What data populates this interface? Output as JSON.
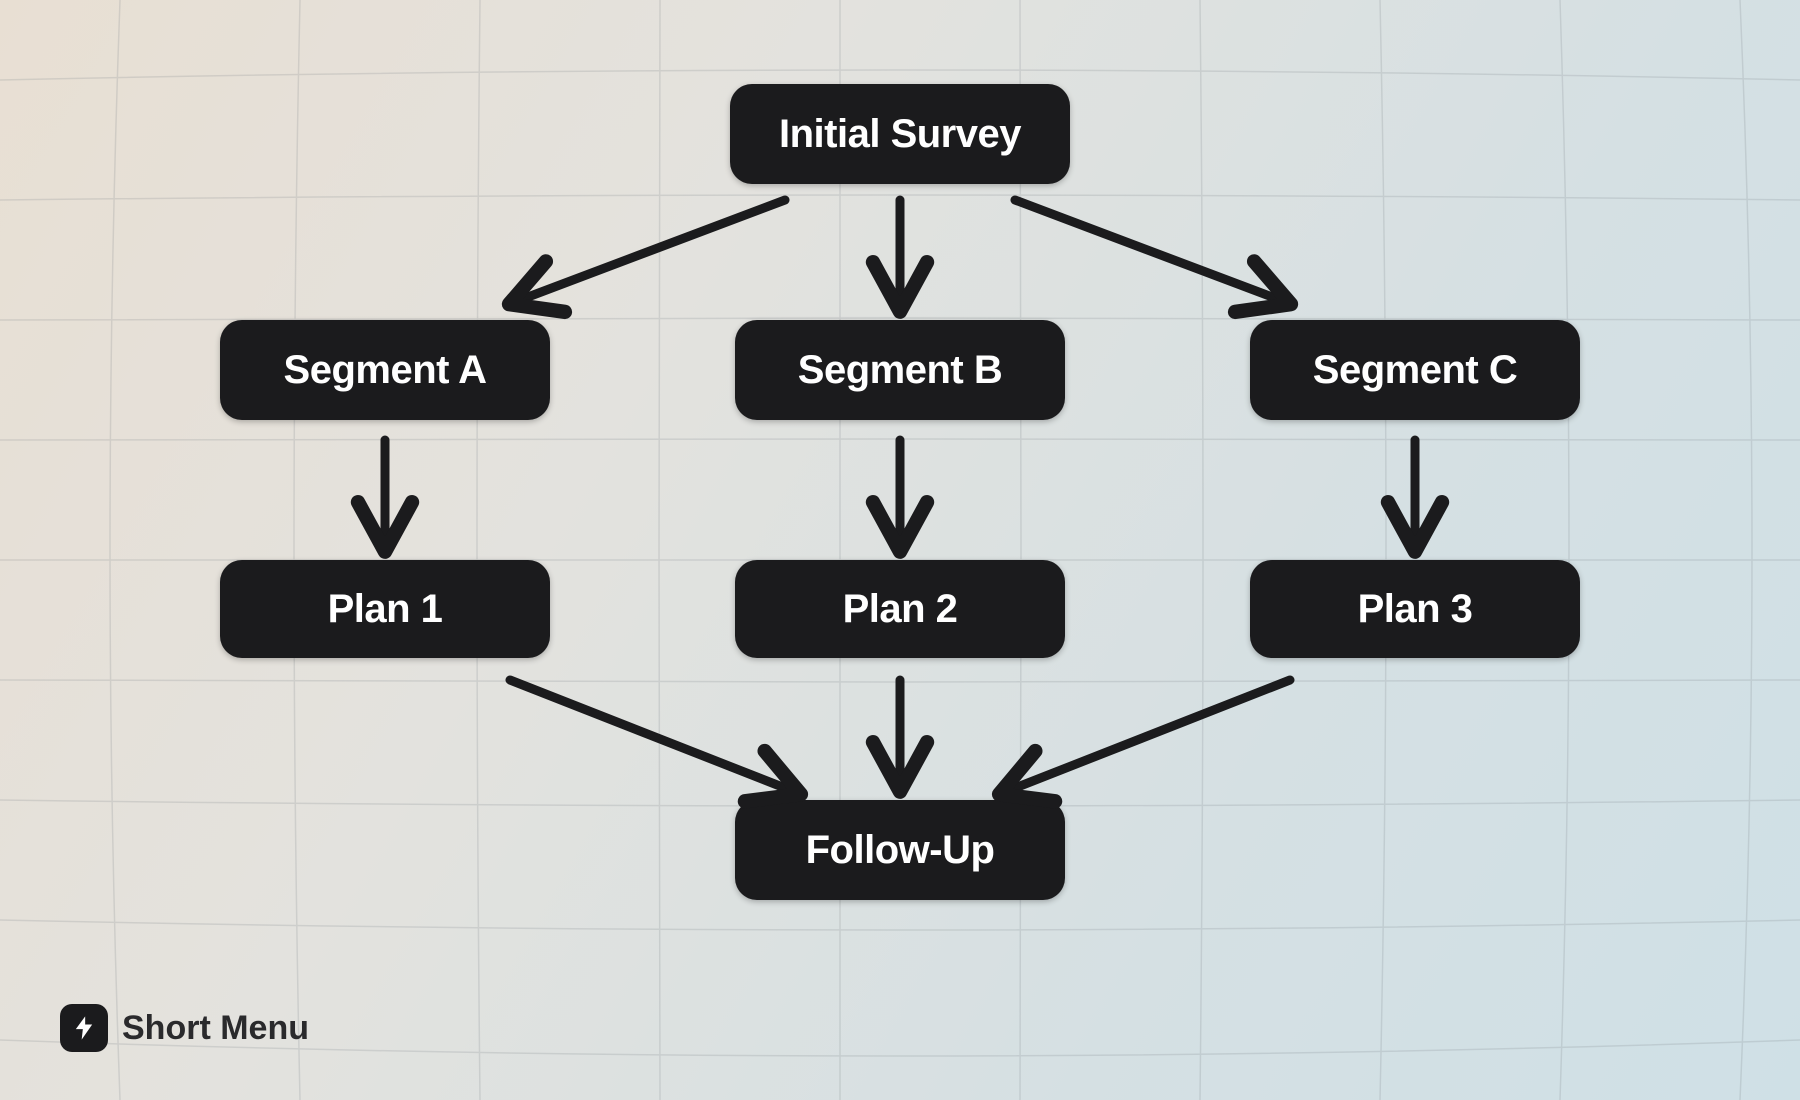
{
  "nodes": {
    "initial_survey": "Initial Survey",
    "segment_a": "Segment A",
    "segment_b": "Segment B",
    "segment_c": "Segment C",
    "plan_1": "Plan 1",
    "plan_2": "Plan 2",
    "plan_3": "Plan 3",
    "follow_up": "Follow-Up"
  },
  "edges": [
    [
      "initial_survey",
      "segment_a"
    ],
    [
      "initial_survey",
      "segment_b"
    ],
    [
      "initial_survey",
      "segment_c"
    ],
    [
      "segment_a",
      "plan_1"
    ],
    [
      "segment_b",
      "plan_2"
    ],
    [
      "segment_c",
      "plan_3"
    ],
    [
      "plan_1",
      "follow_up"
    ],
    [
      "plan_2",
      "follow_up"
    ],
    [
      "plan_3",
      "follow_up"
    ]
  ],
  "brand": {
    "label": "Short Menu"
  },
  "colors": {
    "node_bg": "#1b1b1d",
    "node_text": "#ffffff",
    "arrow": "#1b1b1d"
  }
}
